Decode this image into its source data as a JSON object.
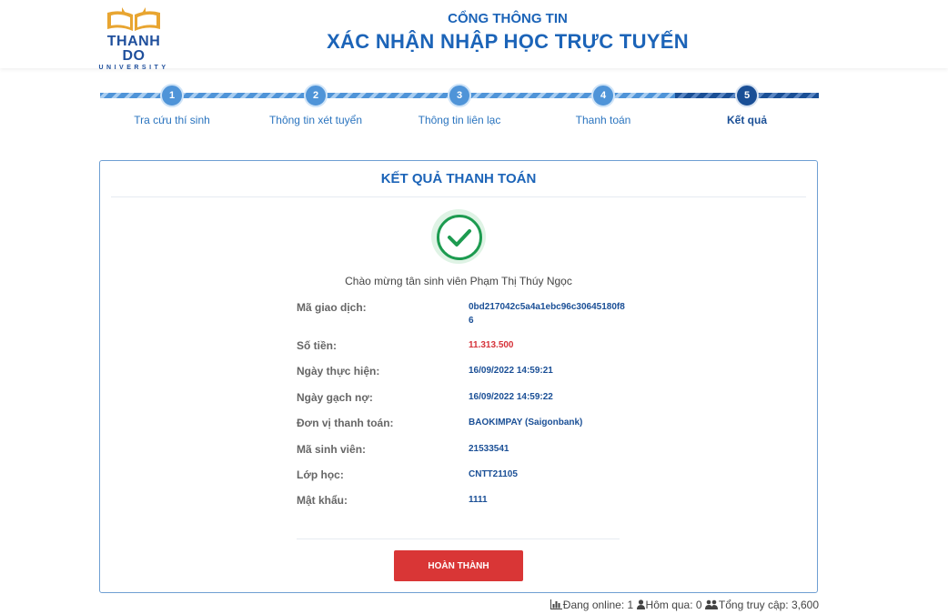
{
  "header": {
    "logo": {
      "name": "THANH DO",
      "sub": "UNIVERSITY"
    },
    "subtitle": "CỔNG THÔNG TIN",
    "title": "XÁC NHẬN NHẬP HỌC TRỰC TUYẾN"
  },
  "steps": [
    {
      "number": "1",
      "label": "Tra cứu thí sinh",
      "active": false
    },
    {
      "number": "2",
      "label": "Thông tin xét tuyển",
      "active": false
    },
    {
      "number": "3",
      "label": "Thông tin liên lạc",
      "active": false
    },
    {
      "number": "4",
      "label": "Thanh toán",
      "active": false
    },
    {
      "number": "5",
      "label": "Kết quả",
      "active": true
    }
  ],
  "result": {
    "title": "KẾT QUẢ THANH TOÁN",
    "welcome": "Chào mừng tân sinh viên Phạm Thị Thúy Ngọc",
    "rows": [
      {
        "label": "Mã giao dịch:",
        "value": "0bd217042c5a4a1ebc96c30645180f86"
      },
      {
        "label": "Số tiền:",
        "value": "11.313.500"
      },
      {
        "label": "Ngày thực hiện:",
        "value": "16/09/2022 14:59:21"
      },
      {
        "label": "Ngày gạch nợ:",
        "value": "16/09/2022 14:59:22"
      },
      {
        "label": "Đơn vị thanh toán:",
        "value": "BAOKIMPAY (Saigonbank)"
      },
      {
        "label": "Mã sinh viên:",
        "value": "21533541"
      },
      {
        "label": "Lớp học:",
        "value": "CNTT21105"
      },
      {
        "label": "Mật khẩu:",
        "value": "1111"
      }
    ],
    "finish_button": "HOÀN THÀNH"
  },
  "stats": {
    "online": "Đang online: 1",
    "yesterday": "Hôm qua: 0",
    "total": "Tổng truy cập: 3,600"
  },
  "colors": {
    "brand_blue": "#1c64b8",
    "dark_blue": "#1a4f96",
    "success_green": "#1d9b50",
    "button_red": "#d93636",
    "amount_red": "#d6333a",
    "logo_gold": "#e8a531"
  }
}
